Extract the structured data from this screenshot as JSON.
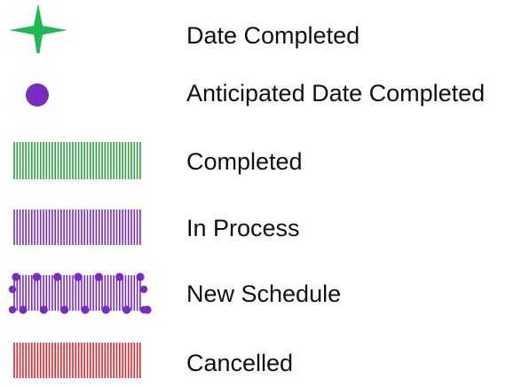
{
  "legend": {
    "items": [
      {
        "key": "date-completed",
        "label": "Date Completed",
        "symbol": "star",
        "color": "#1db954"
      },
      {
        "key": "anticipated-date-completed",
        "label": "Anticipated Date Completed",
        "symbol": "dot",
        "color": "#7b2cbf"
      },
      {
        "key": "completed",
        "label": "Completed",
        "symbol": "hatch",
        "color": "#2ea043"
      },
      {
        "key": "in-process",
        "label": "In Process",
        "symbol": "hatch",
        "color": "#7b2cbf"
      },
      {
        "key": "new-schedule",
        "label": "New Schedule",
        "symbol": "dotted-hatch",
        "color": "#7b2cbf"
      },
      {
        "key": "cancelled",
        "label": "Cancelled",
        "symbol": "hatch",
        "color": "#e3262b"
      }
    ]
  }
}
